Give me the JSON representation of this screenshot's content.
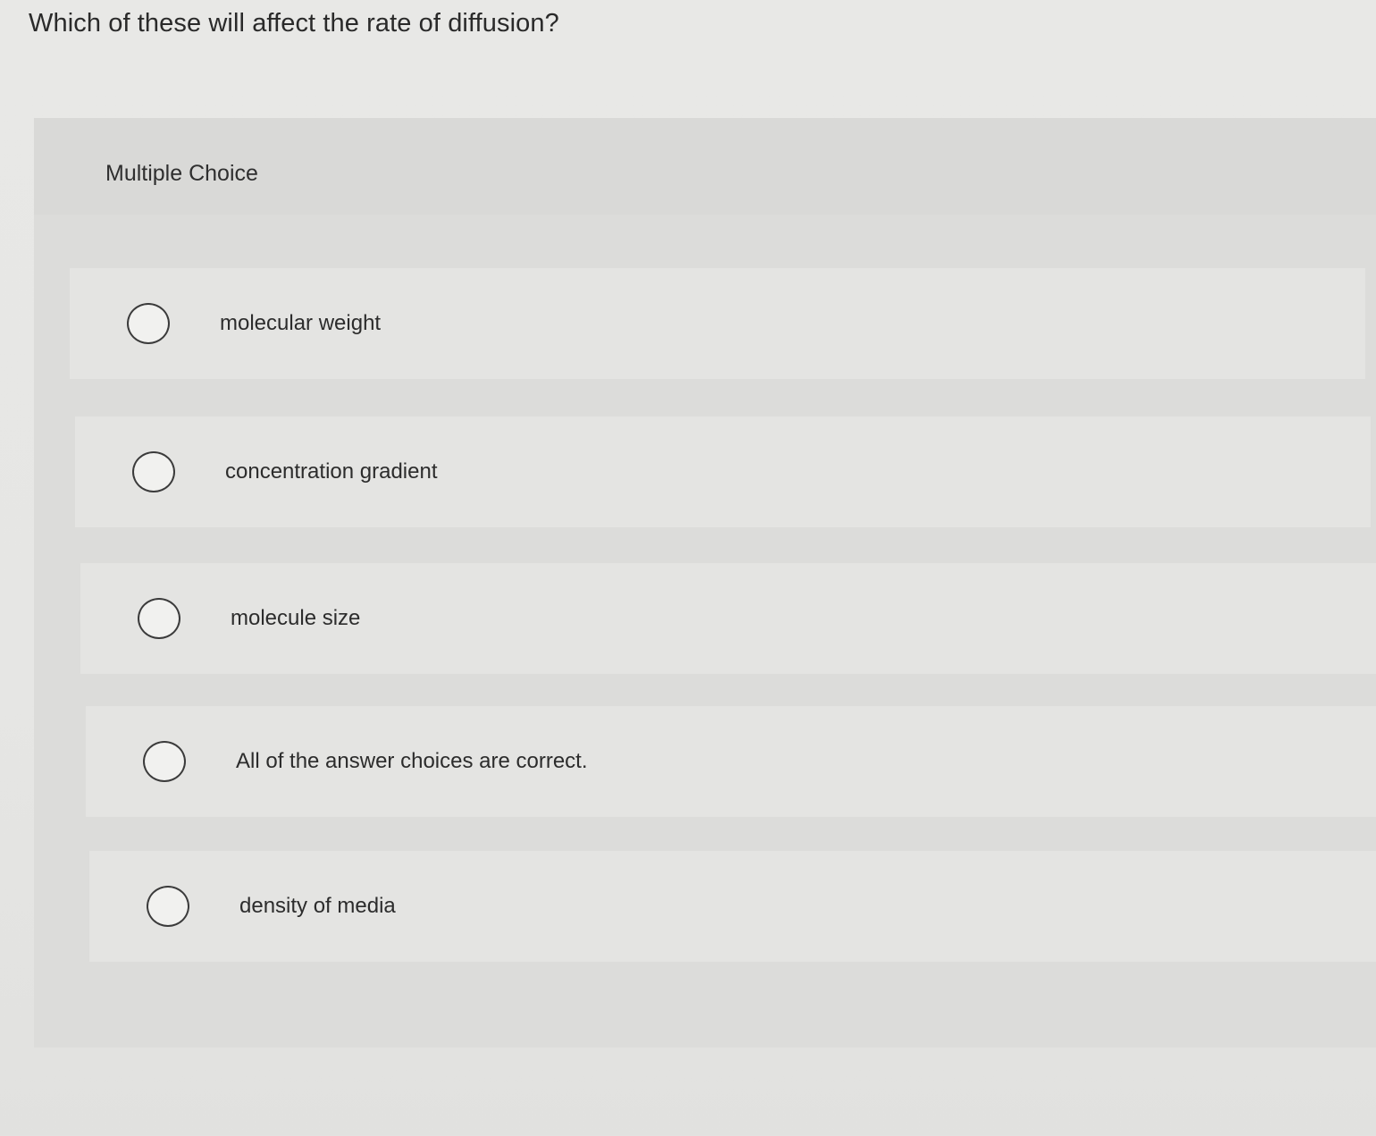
{
  "question": {
    "text": "Which of these will affect the rate of diffusion?"
  },
  "card": {
    "label": "Multiple Choice"
  },
  "options": [
    {
      "label": "molecular weight"
    },
    {
      "label": "concentration gradient"
    },
    {
      "label": "molecule size"
    },
    {
      "label": "All of the answer choices are correct."
    },
    {
      "label": "density of media"
    }
  ]
}
